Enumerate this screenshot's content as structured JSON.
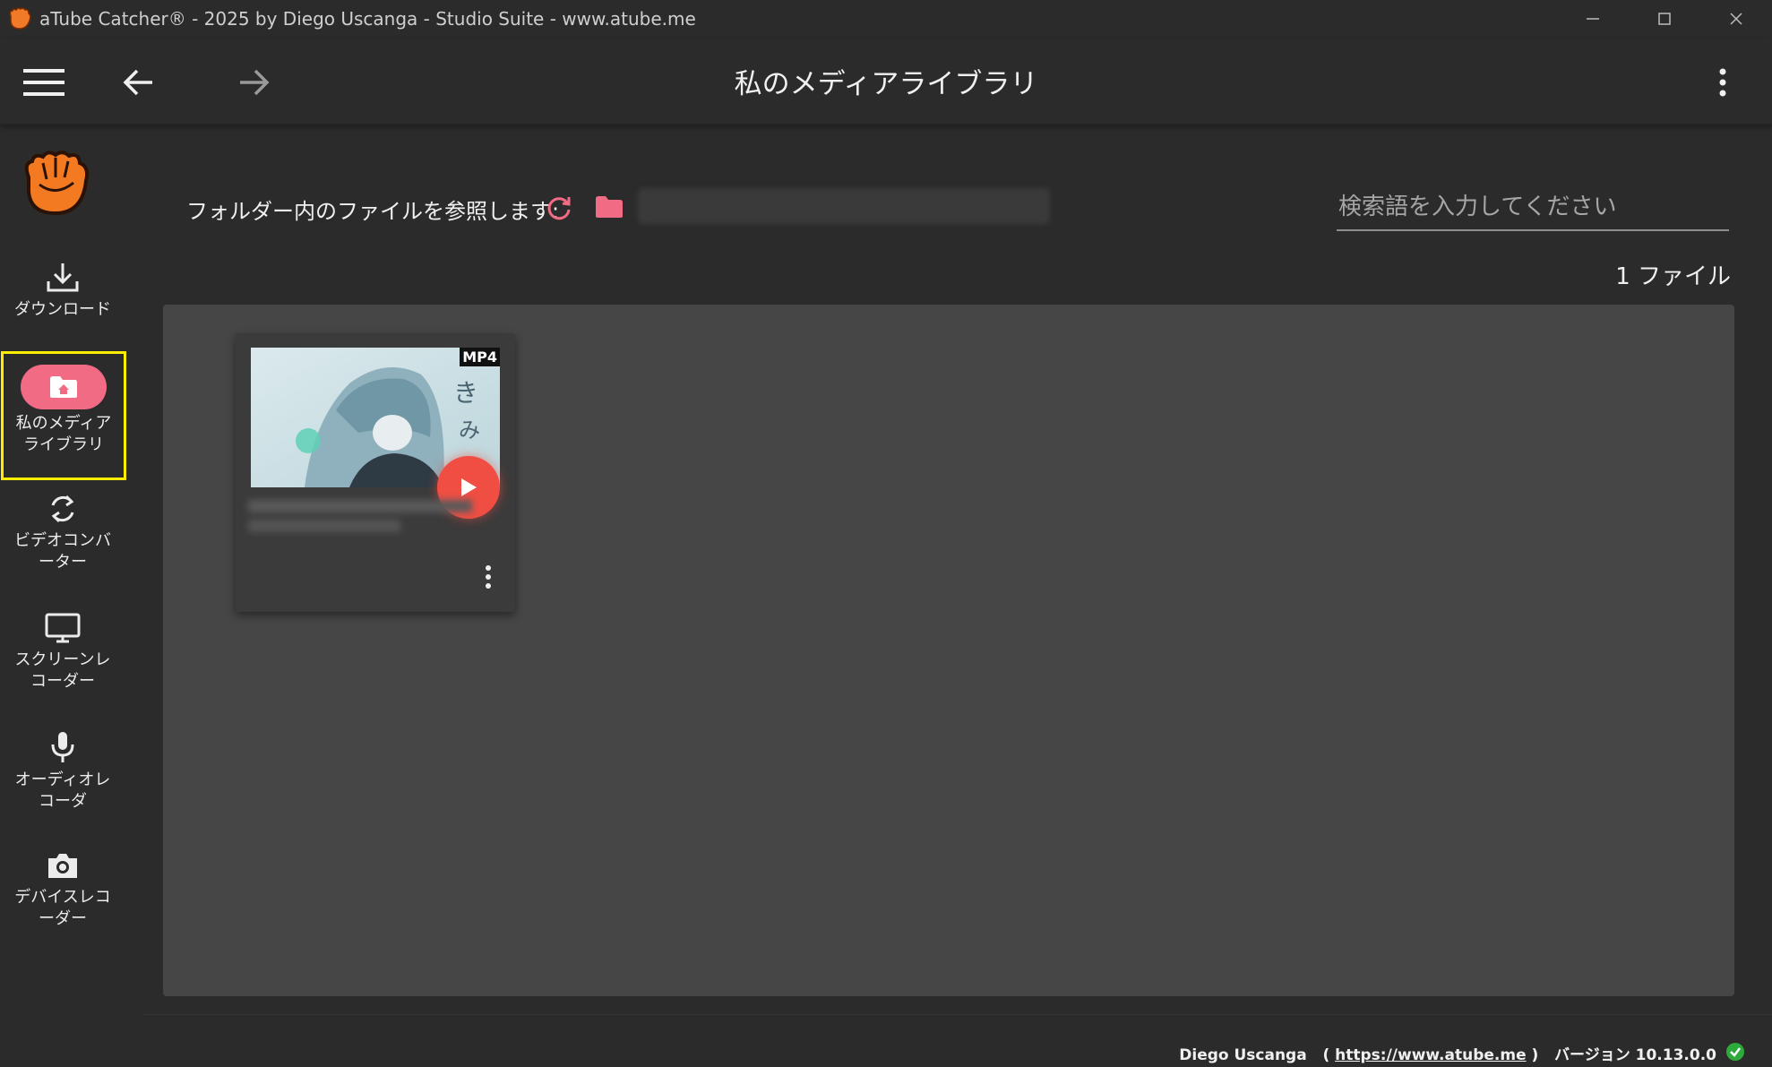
{
  "window": {
    "title": "aTube Catcher® - 2025 by Diego Uscanga - Studio Suite - www.atube.me"
  },
  "header": {
    "page_title": "私のメディアライブラリ"
  },
  "sidebar": {
    "items": [
      {
        "label": "ダウンロード",
        "icon": "download-icon"
      },
      {
        "label": "私のメディアライブラリ",
        "icon": "folder-home-icon"
      },
      {
        "label": "ビデオコンバーター",
        "icon": "sync-icon"
      },
      {
        "label": "スクリーンレコーダー",
        "icon": "monitor-icon"
      },
      {
        "label": "オーディオレコーダ",
        "icon": "microphone-icon"
      },
      {
        "label": "デバイスレコーダー",
        "icon": "camera-icon"
      }
    ]
  },
  "browse": {
    "label": "フォルダー内のファイルを参照します:",
    "search_placeholder": "検索語を入力してください",
    "file_count": "1 ファイル"
  },
  "media": [
    {
      "format": "MP4"
    }
  ],
  "footer": {
    "author": "Diego Uscanga",
    "link": "https://www.atube.me",
    "version": "バージョン 10.13.0.0"
  },
  "colors": {
    "accent": "#f26b84",
    "play": "#f04e43",
    "highlight": "#ffee00"
  }
}
